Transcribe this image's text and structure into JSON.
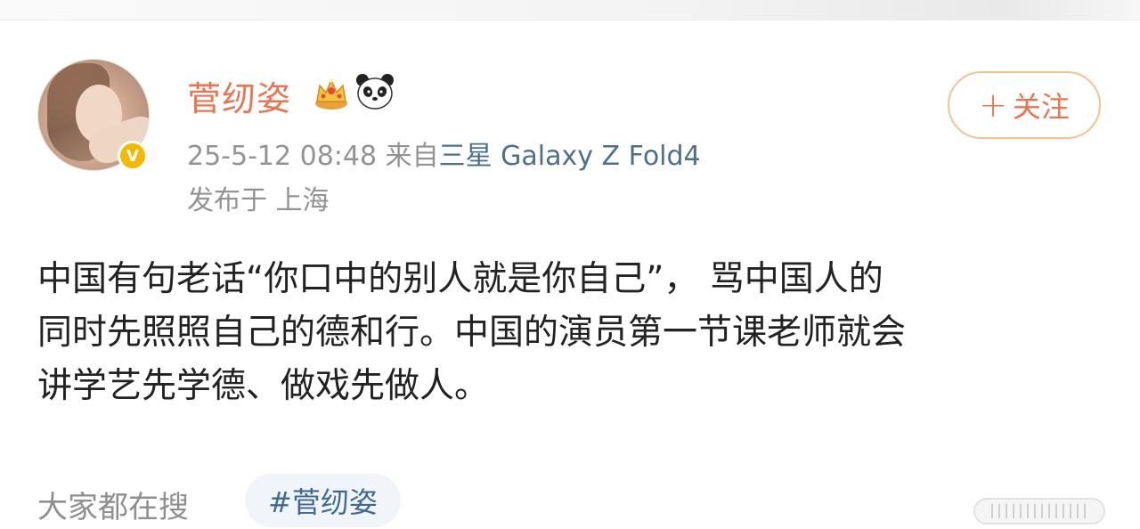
{
  "post": {
    "author": {
      "name": "菅纫姿",
      "badges": [
        "crown-icon",
        "panda-icon"
      ],
      "verified": true
    },
    "follow_button": {
      "plus": "+",
      "label": "关注"
    },
    "timestamp": "25-5-12 08:48",
    "source_prefix": "来自",
    "source_device": "三星 Galaxy Z Fold4",
    "location": "发布于 上海",
    "text_lines": [
      "中国有句老话“你口中的别人就是你自己”， 骂中国人的",
      "同时先照照自己的德和行。中国的演员第一节课老师就会",
      "讲学艺先学德、做戏先做人。"
    ],
    "search_label": "大家都在搜",
    "hashtag": "#菅纫姿"
  },
  "colors": {
    "accent": "#eb7350",
    "link": "#4e6f8c",
    "muted": "#939393",
    "verified": "#f5b800",
    "follow_border": "#f4c28f",
    "tag_bg": "#f1f5f9",
    "tag_text": "#3d6a94"
  }
}
